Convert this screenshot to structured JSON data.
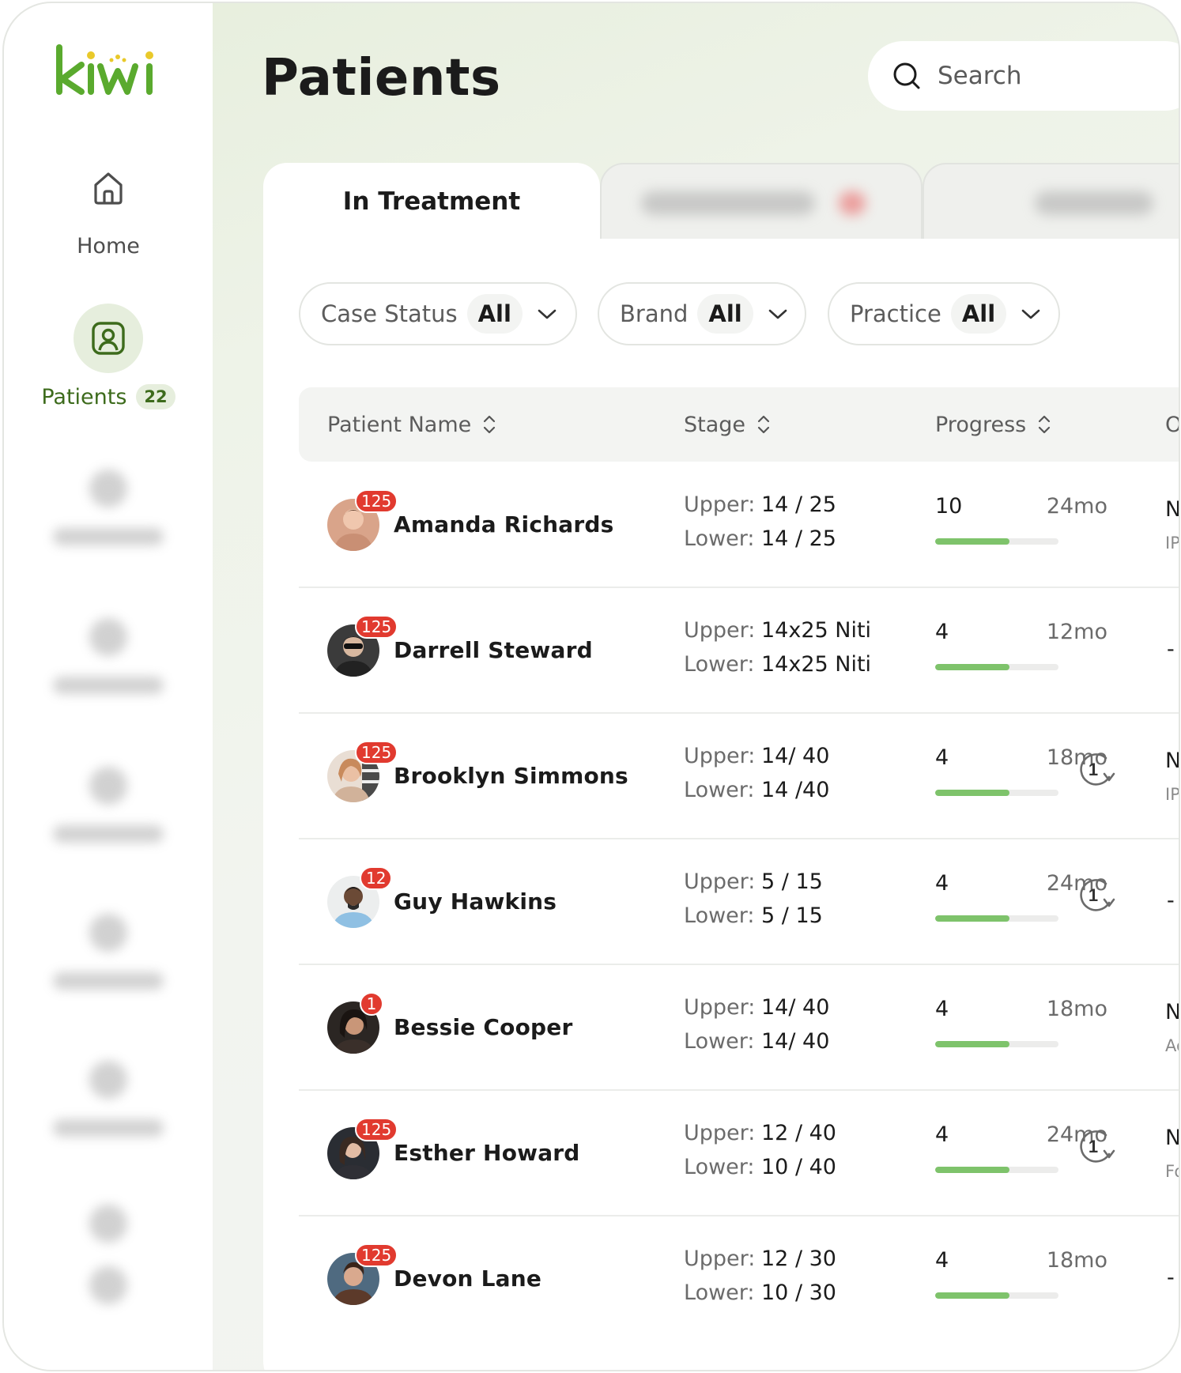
{
  "app": {
    "logo_text": "kiwi",
    "brand_color": "#5aaa2e",
    "accent_color": "#3d6b1c"
  },
  "sidebar": {
    "items": [
      {
        "label": "Home",
        "icon": "home-icon"
      },
      {
        "label": "Patients",
        "icon": "user-card-icon",
        "count": "22",
        "active": true
      }
    ]
  },
  "header": {
    "title": "Patients"
  },
  "search": {
    "placeholder": "Search"
  },
  "tabs": [
    {
      "label": "In Treatment",
      "active": true
    }
  ],
  "filters": [
    {
      "label": "Case Status",
      "value": "All"
    },
    {
      "label": "Brand",
      "value": "All"
    },
    {
      "label": "Practice",
      "value": "All"
    }
  ],
  "table": {
    "columns": [
      "Patient Name",
      "Stage",
      "Progress",
      "Of"
    ],
    "rows": [
      {
        "name": "Amanda Richards",
        "badge": "125",
        "upper_label": "Upper:",
        "upper": "14 / 25",
        "lower_label": "Lower:",
        "lower": "14 / 25",
        "progress": "10",
        "duration": "24mo",
        "progress_fraction": 0.6,
        "cycle": false,
        "cycle_num": "",
        "col4": "Nc",
        "col4_sub": "IPR"
      },
      {
        "name": "Darrell Steward",
        "badge": "125",
        "upper_label": "Upper:",
        "upper": "14x25 Niti",
        "lower_label": "Lower:",
        "lower": "14x25 Niti",
        "progress": "4",
        "duration": "12mo",
        "progress_fraction": 0.6,
        "cycle": false,
        "cycle_num": "",
        "col4": "-",
        "col4_sub": ""
      },
      {
        "name": "Brooklyn Simmons",
        "badge": "125",
        "upper_label": "Upper:",
        "upper": "14/ 40",
        "lower_label": "Lower:",
        "lower": "14 /40",
        "progress": "4",
        "duration": "18mo",
        "progress_fraction": 0.6,
        "cycle": true,
        "cycle_num": "1",
        "col4": "Nc",
        "col4_sub": "IPR"
      },
      {
        "name": "Guy Hawkins",
        "badge": "12",
        "upper_label": "Upper:",
        "upper": "5 / 15",
        "lower_label": "Lower:",
        "lower": "5 / 15",
        "progress": "4",
        "duration": "24mo",
        "progress_fraction": 0.6,
        "cycle": true,
        "cycle_num": "1",
        "col4": "-",
        "col4_sub": ""
      },
      {
        "name": "Bessie Cooper",
        "badge": "1",
        "upper_label": "Upper:",
        "upper": "14/ 40",
        "lower_label": "Lower:",
        "lower": "14/ 40",
        "progress": "4",
        "duration": "18mo",
        "progress_fraction": 0.6,
        "cycle": false,
        "cycle_num": "",
        "col4": "Nc",
        "col4_sub": "Ad"
      },
      {
        "name": "Esther Howard",
        "badge": "125",
        "upper_label": "Upper:",
        "upper": "12 / 40",
        "lower_label": "Lower:",
        "lower": "10 / 40",
        "progress": "4",
        "duration": "24mo",
        "progress_fraction": 0.6,
        "cycle": true,
        "cycle_num": "1",
        "col4": "Nc",
        "col4_sub": "Fo"
      },
      {
        "name": "Devon Lane",
        "badge": "125",
        "upper_label": "Upper:",
        "upper": "12 / 30",
        "lower_label": "Lower:",
        "lower": "10 / 30",
        "progress": "4",
        "duration": "18mo",
        "progress_fraction": 0.6,
        "cycle": false,
        "cycle_num": "",
        "col4": "-",
        "col4_sub": ""
      }
    ]
  }
}
